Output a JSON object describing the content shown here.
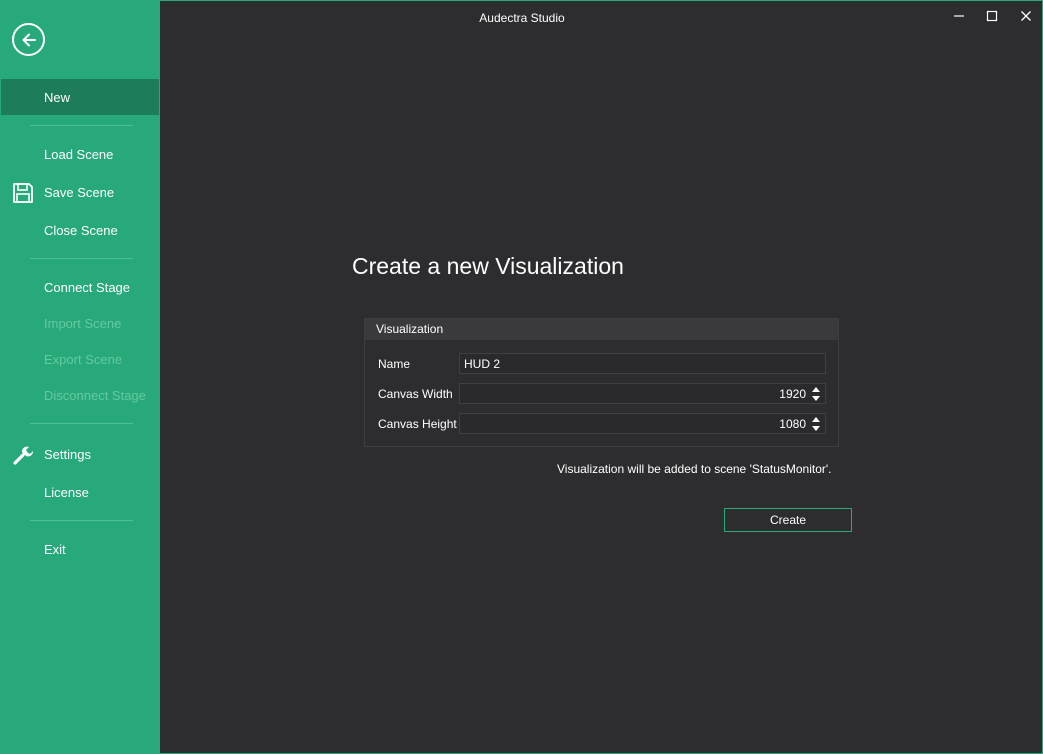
{
  "app": {
    "title": "Audectra Studio"
  },
  "window_controls": {
    "minimize_icon": "minimize-icon",
    "maximize_icon": "maximize-icon",
    "close_icon": "close-icon"
  },
  "sidebar": {
    "back_icon": "arrow-left-circle-icon",
    "items": [
      {
        "label": "New",
        "active": true,
        "enabled": true
      },
      {
        "label": "Load Scene",
        "enabled": true
      },
      {
        "label": "Save Scene",
        "enabled": true,
        "icon": "floppy-disk-icon"
      },
      {
        "label": "Close Scene",
        "enabled": true
      },
      {
        "label": "Connect Stage",
        "enabled": true
      },
      {
        "label": "Import Scene",
        "enabled": false
      },
      {
        "label": "Export Scene",
        "enabled": false
      },
      {
        "label": "Disconnect Stage",
        "enabled": false
      },
      {
        "label": "Settings",
        "enabled": true,
        "icon": "wrench-icon"
      },
      {
        "label": "License",
        "enabled": true
      },
      {
        "label": "Exit",
        "enabled": true
      }
    ]
  },
  "main": {
    "title": "Create a new Visualization",
    "group": {
      "header": "Visualization",
      "name_label": "Name",
      "name_value": "HUD 2",
      "width_label": "Canvas Width",
      "width_value": "1920",
      "height_label": "Canvas Height",
      "height_value": "1080"
    },
    "info": "Visualization will be added to scene 'StatusMonitor'.",
    "create_label": "Create"
  },
  "colors": {
    "accent": "#27a97a",
    "accent_dark": "#1d7d59",
    "background": "#2d2d30",
    "disabled_text": "#65c9a2"
  }
}
